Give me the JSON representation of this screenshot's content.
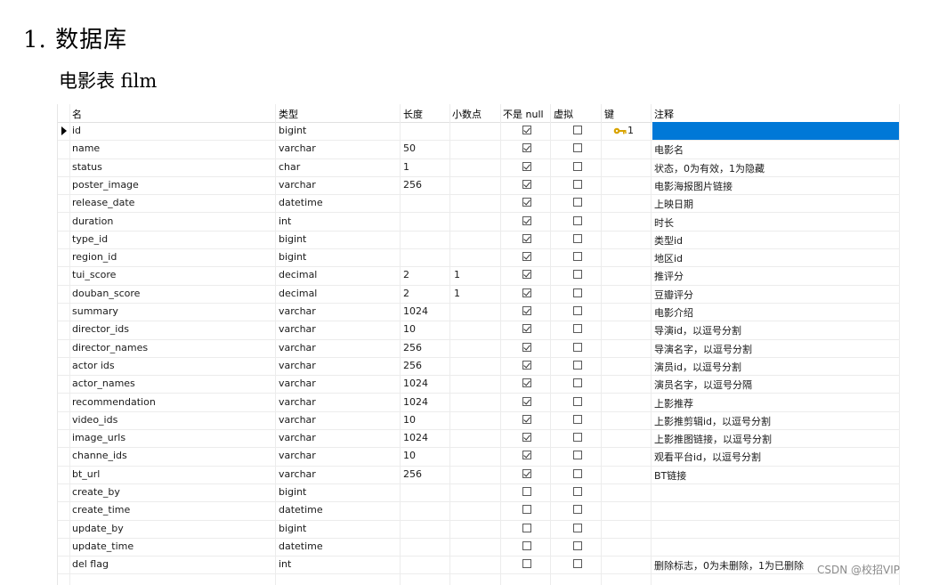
{
  "heading": "1. 数据库",
  "subheading": "电影表 film",
  "columns": [
    "名",
    "类型",
    "长度",
    "小数点",
    "不是 null",
    "虚拟",
    "键",
    "注释"
  ],
  "rows": [
    {
      "name": "id",
      "type": "bigint",
      "length": "",
      "decimals": "",
      "not_null": true,
      "virtual": false,
      "key": "1",
      "comment": ""
    },
    {
      "name": "name",
      "type": "varchar",
      "length": "50",
      "decimals": "",
      "not_null": true,
      "virtual": false,
      "key": "",
      "comment": "电影名"
    },
    {
      "name": "status",
      "type": "char",
      "length": "1",
      "decimals": "",
      "not_null": true,
      "virtual": false,
      "key": "",
      "comment": "状态，0为有效，1为隐藏"
    },
    {
      "name": "poster_image",
      "type": "varchar",
      "length": "256",
      "decimals": "",
      "not_null": true,
      "virtual": false,
      "key": "",
      "comment": "电影海报图片链接"
    },
    {
      "name": "release_date",
      "type": "datetime",
      "length": "",
      "decimals": "",
      "not_null": true,
      "virtual": false,
      "key": "",
      "comment": "上映日期"
    },
    {
      "name": "duration",
      "type": "int",
      "length": "",
      "decimals": "",
      "not_null": true,
      "virtual": false,
      "key": "",
      "comment": "时长"
    },
    {
      "name": "type_id",
      "type": "bigint",
      "length": "",
      "decimals": "",
      "not_null": true,
      "virtual": false,
      "key": "",
      "comment": "类型id"
    },
    {
      "name": "region_id",
      "type": "bigint",
      "length": "",
      "decimals": "",
      "not_null": true,
      "virtual": false,
      "key": "",
      "comment": "地区id"
    },
    {
      "name": "tui_score",
      "type": "decimal",
      "length": "2",
      "decimals": "1",
      "not_null": true,
      "virtual": false,
      "key": "",
      "comment": "推评分"
    },
    {
      "name": "douban_score",
      "type": "decimal",
      "length": "2",
      "decimals": "1",
      "not_null": true,
      "virtual": false,
      "key": "",
      "comment": "豆瓣评分"
    },
    {
      "name": "summary",
      "type": "varchar",
      "length": "1024",
      "decimals": "",
      "not_null": true,
      "virtual": false,
      "key": "",
      "comment": "电影介绍"
    },
    {
      "name": "director_ids",
      "type": "varchar",
      "length": "10",
      "decimals": "",
      "not_null": true,
      "virtual": false,
      "key": "",
      "comment": "导演id，以逗号分割"
    },
    {
      "name": "director_names",
      "type": "varchar",
      "length": "256",
      "decimals": "",
      "not_null": true,
      "virtual": false,
      "key": "",
      "comment": "导演名字，以逗号分割"
    },
    {
      "name": "actor ids",
      "type": "varchar",
      "length": "256",
      "decimals": "",
      "not_null": true,
      "virtual": false,
      "key": "",
      "comment": "演员id，以逗号分割"
    },
    {
      "name": "actor_names",
      "type": "varchar",
      "length": "1024",
      "decimals": "",
      "not_null": true,
      "virtual": false,
      "key": "",
      "comment": "演员名字，以逗号分隔"
    },
    {
      "name": "recommendation",
      "type": "varchar",
      "length": "1024",
      "decimals": "",
      "not_null": true,
      "virtual": false,
      "key": "",
      "comment": "上影推荐"
    },
    {
      "name": "video_ids",
      "type": "varchar",
      "length": "10",
      "decimals": "",
      "not_null": true,
      "virtual": false,
      "key": "",
      "comment": "上影推剪辑id，以逗号分割"
    },
    {
      "name": "image_urls",
      "type": "varchar",
      "length": "1024",
      "decimals": "",
      "not_null": true,
      "virtual": false,
      "key": "",
      "comment": "上影推图链接，以逗号分割"
    },
    {
      "name": "channe_ids",
      "type": "varchar",
      "length": "10",
      "decimals": "",
      "not_null": true,
      "virtual": false,
      "key": "",
      "comment": "观看平台id，以逗号分割"
    },
    {
      "name": "bt_url",
      "type": "varchar",
      "length": "256",
      "decimals": "",
      "not_null": true,
      "virtual": false,
      "key": "",
      "comment": "BT链接"
    },
    {
      "name": "create_by",
      "type": "bigint",
      "length": "",
      "decimals": "",
      "not_null": false,
      "virtual": false,
      "key": "",
      "comment": ""
    },
    {
      "name": "create_time",
      "type": "datetime",
      "length": "",
      "decimals": "",
      "not_null": false,
      "virtual": false,
      "key": "",
      "comment": ""
    },
    {
      "name": "update_by",
      "type": "bigint",
      "length": "",
      "decimals": "",
      "not_null": false,
      "virtual": false,
      "key": "",
      "comment": ""
    },
    {
      "name": "update_time",
      "type": "datetime",
      "length": "",
      "decimals": "",
      "not_null": false,
      "virtual": false,
      "key": "",
      "comment": ""
    },
    {
      "name": "del flag",
      "type": "int",
      "length": "",
      "decimals": "",
      "not_null": false,
      "virtual": false,
      "key": "",
      "comment": "删除标志，0为未删除，1为已删除"
    }
  ],
  "watermark": "CSDN @校招VIP",
  "colors": {
    "selection": "#0078d7",
    "key_icon": "#d9a400"
  },
  "icons": {
    "row_marker": "current-row-marker-icon",
    "key": "key-icon"
  }
}
